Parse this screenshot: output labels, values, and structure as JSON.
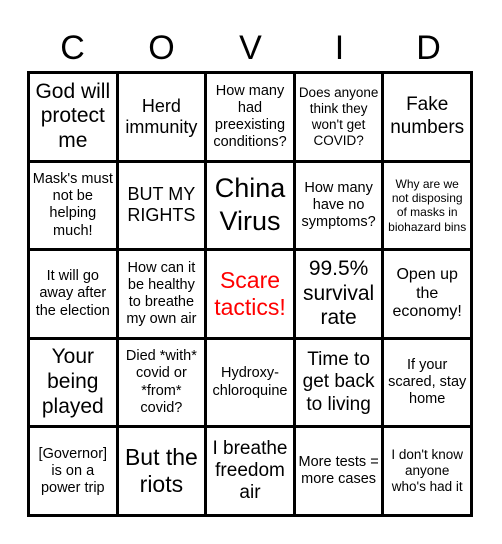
{
  "header": [
    "C",
    "O",
    "V",
    "I",
    "D"
  ],
  "cells": [
    {
      "text": "God will protect me",
      "size": "s21"
    },
    {
      "text": "Herd immunity",
      "size": "s18"
    },
    {
      "text": "How many had preexisting conditions?",
      "size": "s14"
    },
    {
      "text": "Does anyone think they won't get COVID?",
      "size": "s13"
    },
    {
      "text": "Fake numbers",
      "size": "s19"
    },
    {
      "text": "Mask's must not be helping much!",
      "size": "s14"
    },
    {
      "text": "BUT MY RIGHTS",
      "size": "s18"
    },
    {
      "text": "China Virus",
      "size": "s27"
    },
    {
      "text": "How many have no symptoms?",
      "size": "s14"
    },
    {
      "text": "Why are we not disposing of masks in biohazard bins",
      "size": "s12"
    },
    {
      "text": "It will go away after the election",
      "size": "s14"
    },
    {
      "text": "How can it be healthy to breathe my own air",
      "size": "s14"
    },
    {
      "text": "Scare tactics!",
      "size": "s23",
      "color": "#ff0000"
    },
    {
      "text": "99.5% survival rate",
      "size": "s21"
    },
    {
      "text": "Open up the economy!",
      "size": "s16"
    },
    {
      "text": "Your being played",
      "size": "s21"
    },
    {
      "text": "Died *with* covid or *from* covid?",
      "size": "s14"
    },
    {
      "text": "Hydroxy-chloroquine",
      "size": "s14"
    },
    {
      "text": "Time to get back to living",
      "size": "s19"
    },
    {
      "text": "If your scared, stay home",
      "size": "s14"
    },
    {
      "text": "[Governor] is on a power trip",
      "size": "s14"
    },
    {
      "text": "But the riots",
      "size": "s23"
    },
    {
      "text": "I breathe freedom air",
      "size": "s19"
    },
    {
      "text": "More tests = more cases",
      "size": "s14"
    },
    {
      "text": "I don't know anyone who's had it",
      "size": "s13"
    }
  ]
}
